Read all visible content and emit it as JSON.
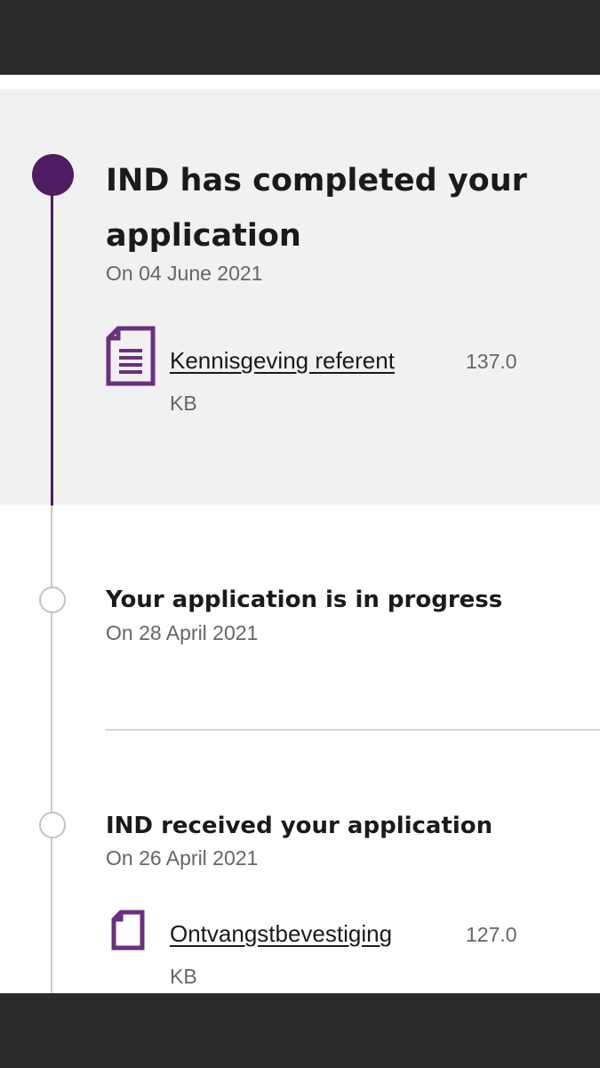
{
  "timeline": {
    "steps": [
      {
        "title": "IND has completed your application",
        "date": "On 04 June 2021",
        "status": "active",
        "document": {
          "name": "Kennisgeving referent",
          "size_value": "137.0",
          "size_unit": "KB",
          "icon": "document-lines-icon"
        }
      },
      {
        "title": "Your application is in progress",
        "date": "On 28 April 2021",
        "status": "inactive"
      },
      {
        "title": "IND received your application",
        "date": "On 26 April 2021",
        "status": "inactive",
        "document": {
          "name": "Ontvangstbevestiging",
          "size_value": "127.0",
          "size_unit": "KB",
          "icon": "document-blank-icon"
        }
      }
    ]
  },
  "colors": {
    "accent": "#4f1c64",
    "highlight_bg": "#f1f1f1",
    "inactive_line": "#c8c8c8",
    "frame": "#2a2a2a"
  }
}
